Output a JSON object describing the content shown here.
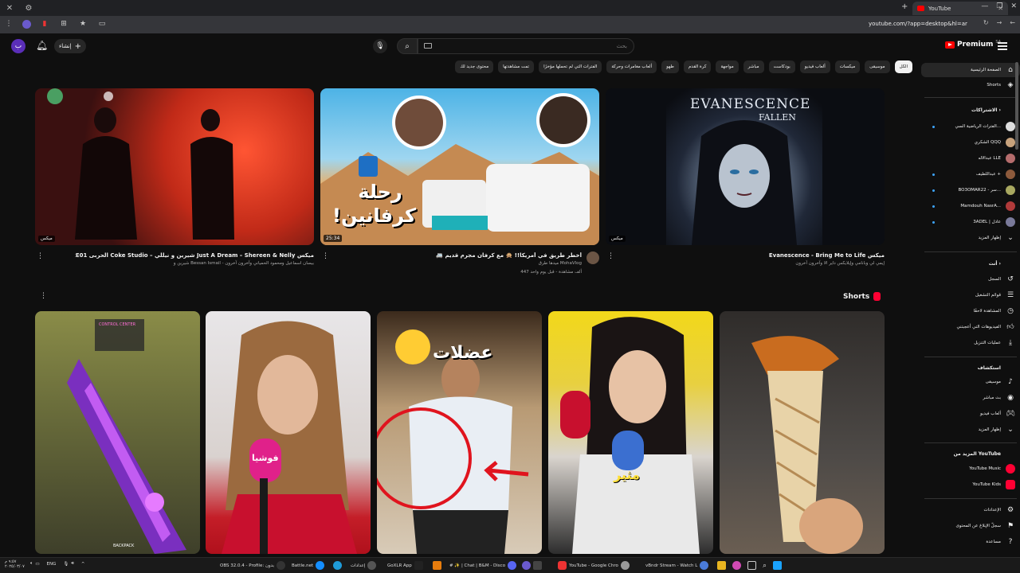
{
  "browser": {
    "tab_title": "YouTube",
    "url": "youtube.com/?app=desktop&hl=ar"
  },
  "header": {
    "avatar_letter": "ب",
    "create_label": "إنشاء",
    "search_placeholder": "بحث",
    "logo_text": "Premium",
    "logo_country": "SA"
  },
  "chips": [
    "الكل",
    "موسيقى",
    "ميكسات",
    "ألعاب فيديو",
    "بودكاست",
    "مباشر",
    "مواجهة",
    "كرة القدم",
    "طهو",
    "ألعاب مغامرات وحركة",
    "الفترات التي لم تحملها مؤخرًا",
    "تمت مشاهدتها",
    "محتوى جديد لك"
  ],
  "sidebar": {
    "home": "الصفحة الرئيسية",
    "shorts": "Shorts",
    "subs_heading": "الاشتراكات",
    "subs": [
      {
        "name": "الفترات الرياضية السي...",
        "dot": true,
        "color": "#dddddd"
      },
      {
        "name": "الشكري QQQ",
        "dot": false,
        "color": "#c7a27c"
      },
      {
        "name": "عبدالاله LLE",
        "dot": false,
        "color": "#b56c6c"
      },
      {
        "name": "عبداللطيف +",
        "dot": true,
        "color": "#8d5a3c"
      },
      {
        "name": "BO3OMAR22 - سر...",
        "dot": true,
        "color": "#a8a860"
      },
      {
        "name": "Mamdouh NasrA...",
        "dot": true,
        "color": "#b03a3a"
      },
      {
        "name": "3ADEL | عادل",
        "dot": true,
        "color": "#7a7a9a"
      }
    ],
    "show_more": "إظهار المزيد",
    "you_heading": "أنت",
    "you_items": [
      "السجل",
      "قوائم التشغيل",
      "المشاهدة لاحقًا",
      "الفيديوهات التي أعجبتني",
      "عمليات التنزيل"
    ],
    "explore_heading": "استكشاف",
    "explore_items": [
      "موسيقى",
      "بث مباشر",
      "ألعاب فيديو",
      "إظهار المزيد"
    ],
    "more_heading": "المزيد من YouTube",
    "more_items": [
      "YouTube Music",
      "YouTube Kids"
    ],
    "bottom_items": [
      "الإعدادات",
      "سجلّ الإبلاغ عن المحتوى",
      "مساعدة"
    ]
  },
  "videos": [
    {
      "title": "ميكس Just A Dream – Shereen & Nelly شيرين و نيللي – Coke Studio الحربى S02E01",
      "meta": "شيرين و Bessan Ismail - بيسان اسماعيل ومحمود الحمياني وآخرون آخرون",
      "meta2": "",
      "badge": "ميكس",
      "duration": ""
    },
    {
      "title": "أخطر طريق في أمريكا!! 🙊 مع كرفان مجرم قديم 🚐",
      "meta": "ميدها طرق MohaVlog",
      "meta2": "447 ألف مشاهدة - قبل يوم واحد",
      "badge": "",
      "duration": "25:34",
      "thumb_text": "رحلة كرفانين!"
    },
    {
      "title": "ميكس Evanescence - Bring Me to Life",
      "meta": "إيمي لي وبانامي وإيلايكس داير الا وآخرون آخرون",
      "meta2": "",
      "badge": "ميكس",
      "duration": "",
      "thumb_text_1": "EVANESCENCE",
      "thumb_text_2": "FALLEN"
    }
  ],
  "shorts": {
    "heading": "Shorts",
    "items": [
      {
        "caption": "BACKPACK",
        "overlay": "CONTROL CENTER"
      },
      {
        "caption": "فوشيا",
        "overlay": ""
      },
      {
        "caption": "عضلات",
        "overlay": ""
      },
      {
        "caption": "مثير",
        "overlay": ""
      },
      {
        "caption": "",
        "overlay": ""
      }
    ]
  },
  "taskbar": {
    "time": "٩:٥٧ م",
    "date": "٢٠٢٥/٠٣/٠٧",
    "lang": "ENG",
    "apps": [
      "OBS 32.0.4 - Profile: بدون",
      "Battle.net",
      "إعدادات",
      "GoXLR App",
      "# ✨ | Chat | B&M - Disco",
      "YouTube - Google Chro",
      "vBndr Stream - Watch L"
    ]
  },
  "colors": {
    "background": "#0f0f0f",
    "brand": "#ff0000",
    "chip": "#272727",
    "text": "#f1f1f1",
    "muted": "#aaaaaa"
  }
}
